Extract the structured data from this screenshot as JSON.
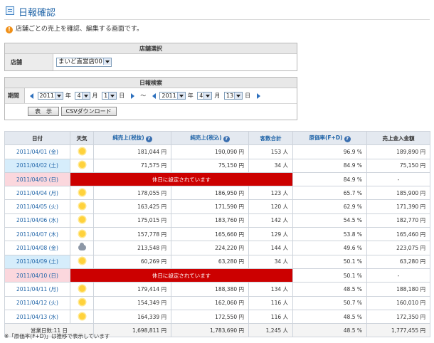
{
  "page": {
    "title": "日報確認",
    "description": "店舗ごとの売上を確認、編集する画面です。",
    "footnote": "※「原価率(F+D)」は推移で表示しています"
  },
  "store_select": {
    "header": "店舗選択",
    "label": "店舗",
    "value": "まいど直営店00"
  },
  "search": {
    "header": "日報検索",
    "period_label": "期間",
    "from": {
      "year": "2011",
      "month": "4",
      "day": "1"
    },
    "to": {
      "year": "2011",
      "month": "4",
      "day": "13"
    },
    "unit_year": "年",
    "unit_month": "月",
    "unit_day": "日",
    "range_sep": "～",
    "show_button": "表　示",
    "csv_button": "CSVダウンロード"
  },
  "table": {
    "headers": {
      "date": "日付",
      "weather": "天気",
      "net_excl": "純売上(税抜)",
      "net_incl": "純売上(税込)",
      "customers": "客数合計",
      "cost_rate": "原価率(F+D)",
      "total_incl": "売上金入金額"
    },
    "holiday_text": "休日に設定されています",
    "rows": [
      {
        "date": "2011/04/01 (金)",
        "type": "weekday",
        "weather": "sunny-icon",
        "net_excl": "181,044 円",
        "net_incl": "190,090 円",
        "customers": "153 人",
        "cost_rate": "96.9 %",
        "total": "189,890 円"
      },
      {
        "date": "2011/04/02 (土)",
        "type": "sat",
        "weather": "sunny-icon",
        "net_excl": "71,575 円",
        "net_incl": "75,150 円",
        "customers": "34 人",
        "cost_rate": "84.9 %",
        "total": "75,150 円"
      },
      {
        "date": "2011/04/03 (日)",
        "type": "sun",
        "holiday": true,
        "cost_rate": "84.9 %",
        "total": "-"
      },
      {
        "date": "2011/04/04 (月)",
        "type": "weekday",
        "weather": "sunny-icon",
        "net_excl": "178,055 円",
        "net_incl": "186,950 円",
        "customers": "123 人",
        "cost_rate": "65.7 %",
        "total": "185,900 円"
      },
      {
        "date": "2011/04/05 (火)",
        "type": "weekday",
        "weather": "sunny-icon",
        "net_excl": "163,425 円",
        "net_incl": "171,590 円",
        "customers": "120 人",
        "cost_rate": "62.9 %",
        "total": "171,390 円"
      },
      {
        "date": "2011/04/06 (水)",
        "type": "weekday",
        "weather": "sunny-icon",
        "net_excl": "175,015 円",
        "net_incl": "183,760 円",
        "customers": "142 人",
        "cost_rate": "54.5 %",
        "total": "182,770 円"
      },
      {
        "date": "2011/04/07 (木)",
        "type": "weekday",
        "weather": "sunny-icon",
        "net_excl": "157,778 円",
        "net_incl": "165,660 円",
        "customers": "129 人",
        "cost_rate": "53.8 %",
        "total": "165,460 円"
      },
      {
        "date": "2011/04/08 (金)",
        "type": "weekday",
        "weather": "cloudy-icon",
        "net_excl": "213,548 円",
        "net_incl": "224,220 円",
        "customers": "144 人",
        "cost_rate": "49.6 %",
        "total": "223,075 円"
      },
      {
        "date": "2011/04/09 (土)",
        "type": "sat",
        "weather": "sunny-icon",
        "net_excl": "60,269 円",
        "net_incl": "63,280 円",
        "customers": "34 人",
        "cost_rate": "50.1 %",
        "total": "63,280 円"
      },
      {
        "date": "2011/04/10 (日)",
        "type": "sun",
        "holiday": true,
        "cost_rate": "50.1 %",
        "total": "-"
      },
      {
        "date": "2011/04/11 (月)",
        "type": "weekday",
        "weather": "sunny-icon",
        "net_excl": "179,414 円",
        "net_incl": "188,380 円",
        "customers": "134 人",
        "cost_rate": "48.5 %",
        "total": "188,180 円"
      },
      {
        "date": "2011/04/12 (火)",
        "type": "weekday",
        "weather": "sunny-icon",
        "net_excl": "154,349 円",
        "net_incl": "162,060 円",
        "customers": "116 人",
        "cost_rate": "50.7 %",
        "total": "160,010 円"
      },
      {
        "date": "2011/04/13 (水)",
        "type": "weekday",
        "weather": "sunny-icon",
        "net_excl": "164,339 円",
        "net_incl": "172,550 円",
        "customers": "116 人",
        "cost_rate": "48.5 %",
        "total": "172,350 円"
      }
    ],
    "total": {
      "label": "営業日数:11 日",
      "net_excl": "1,698,811 円",
      "net_incl": "1,783,690 円",
      "customers": "1,245 人",
      "cost_rate": "48.5 %",
      "total": "1,777,455 円"
    }
  },
  "colors": {
    "accent": "#1f64a8",
    "holiday": "#cc0000",
    "saturday": "#d6edfb",
    "sunday": "#fbd7dd"
  }
}
